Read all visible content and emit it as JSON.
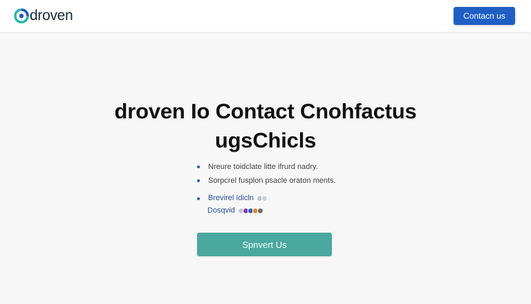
{
  "header": {
    "logo_text": "droven",
    "contact_label": "Contacn us"
  },
  "hero": {
    "title_line1": "droven Io Contact Cnohfactus",
    "title_line2": "ugsChicls"
  },
  "features": [
    {
      "text": "Nreure toidclate litte ifrurd nadry."
    },
    {
      "text": "Sorpcrel fusplon psacle oraton ments."
    }
  ],
  "partners": {
    "row1_label": "Brevirel Idicln",
    "row2_label": "Dosqvid"
  },
  "cta": {
    "label": "Spnvert Us"
  },
  "colors": {
    "brand_blue": "#1f5fc4",
    "cta_teal": "#4aa8a0",
    "logo_teal": "#2bb5a8",
    "logo_blue": "#2157c2"
  },
  "icons": [
    "logo-mark-icon",
    "bullet-icon",
    "partner-chip-icon"
  ]
}
